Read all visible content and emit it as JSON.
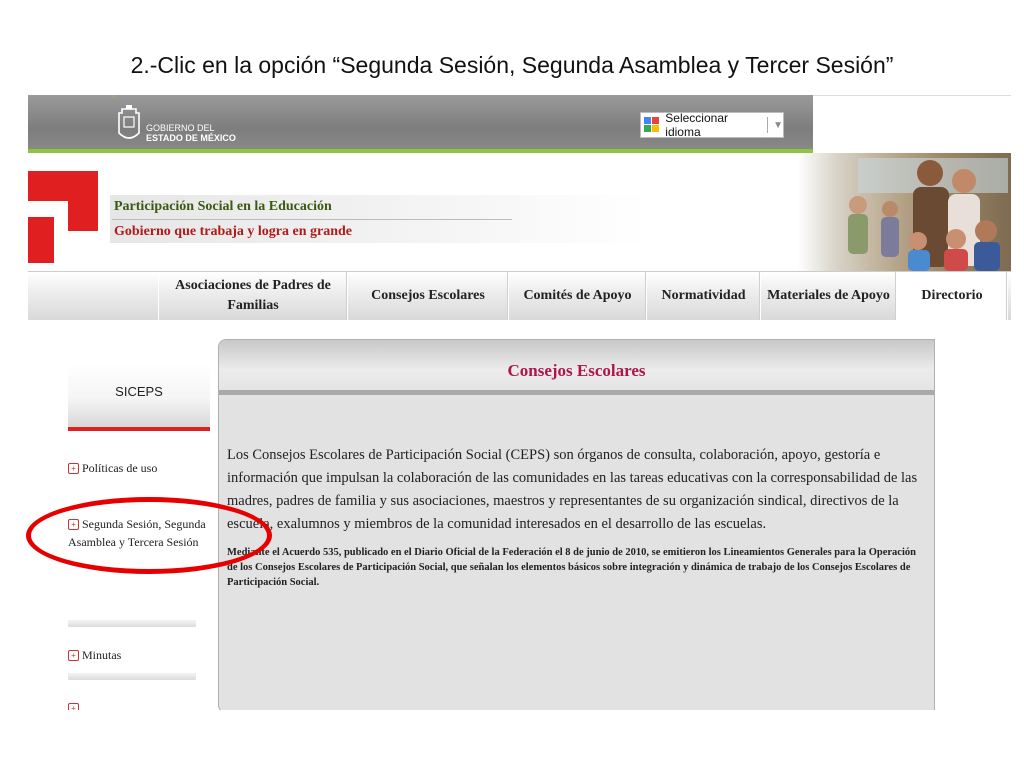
{
  "slide": {
    "instruction": "2.-Clic en la opción “Segunda Sesión, Segunda Asamblea y Tercer Sesión”"
  },
  "header": {
    "gov_line1": "GOBIERNO DEL",
    "gov_line2": "ESTADO DE MÉXICO",
    "language_select": "Seleccionar idioma",
    "language_arrow": "▼"
  },
  "brand": {
    "subtitle": "Participación Social en la Educación",
    "slogan": "Gobierno que trabaja y logra en grande"
  },
  "nav": {
    "items": [
      {
        "label": "Asociaciones de Padres de Familias"
      },
      {
        "label": "Consejos Escolares"
      },
      {
        "label": "Comités de Apoyo"
      },
      {
        "label": "Normatividad"
      },
      {
        "label": "Materiales de Apoyo"
      },
      {
        "label": "Directorio"
      }
    ]
  },
  "sidebar": {
    "title": "SICEPS",
    "links": [
      {
        "label": "Políticas de uso"
      },
      {
        "label": "Segunda Sesión, Segunda Asamblea y Tercera Sesión"
      },
      {
        "label": "Minutas"
      }
    ]
  },
  "content": {
    "title": "Consejos Escolares",
    "paragraph1": "Los Consejos Escolares de Participación Social (CEPS) son órganos de consulta, colaboración, apoyo, gestoría e información que impulsan la colaboración de las comunidades en las tareas educativas con la corresponsabilidad de las madres, padres de familia y sus asociaciones, maestros y representantes de su organización sindical, directivos de la escuela, exalumnos y miembros de la comunidad interesados en el desarrollo de las escuelas.",
    "paragraph2": "Mediante el Acuerdo 535, publicado en el Diario Oficial de la Federación el 8 de junio de 2010, se emitieron los Lineamientos Generales para la Operación de los Consejos Escolares de Participación Social, que señalan los elementos básicos sobre integración y dinámica de trabajo de los Consejos Escolares de Participación Social."
  },
  "colors": {
    "accent_red": "#e02020",
    "brand_green": "#8cc63f",
    "title_magenta": "#b0154a"
  }
}
